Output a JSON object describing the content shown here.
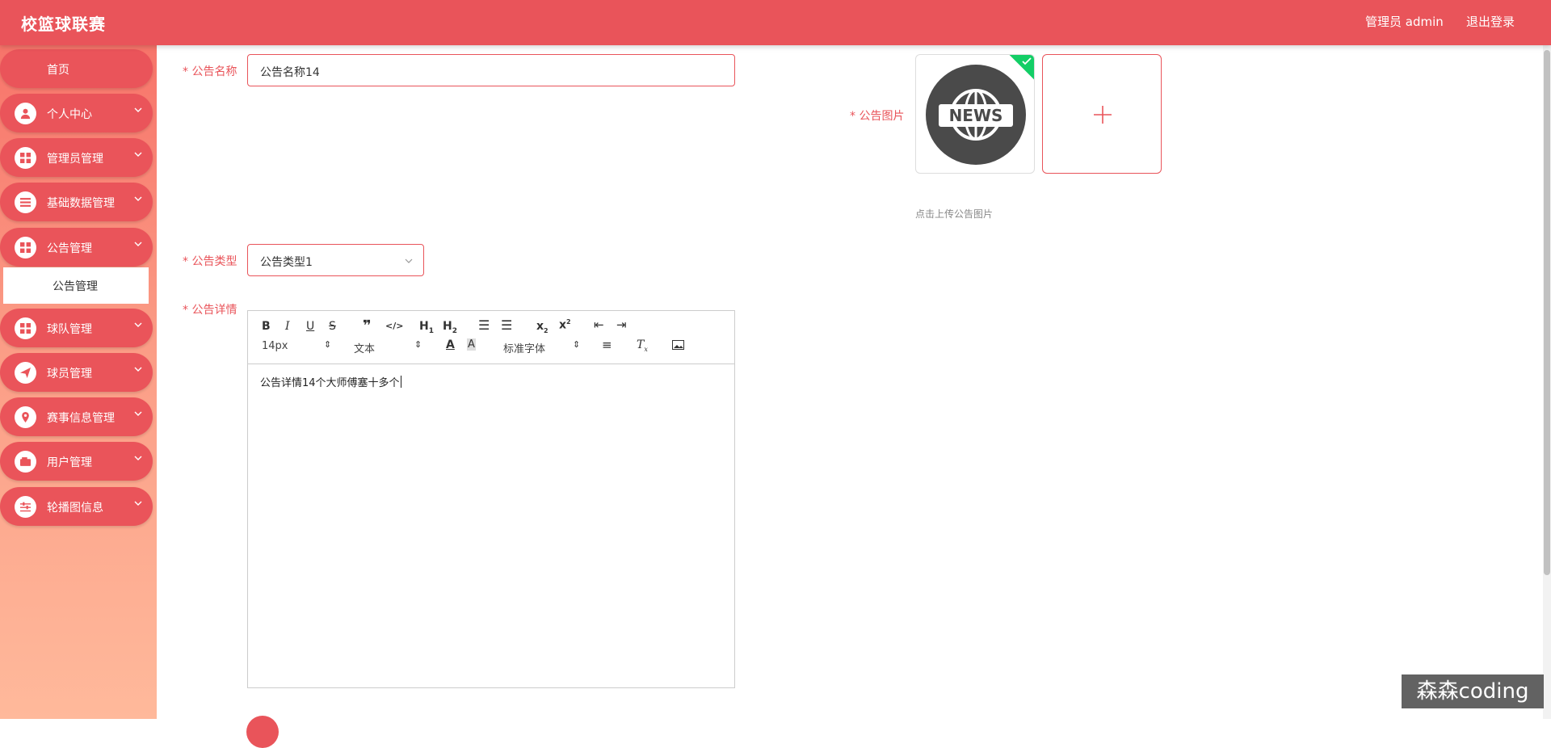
{
  "header": {
    "app_title": "校篮球联赛",
    "admin_label": "管理员 admin",
    "logout_label": "退出登录"
  },
  "sidebar": {
    "items": [
      {
        "label": "首页",
        "icon": "home-icon"
      },
      {
        "label": "个人中心",
        "icon": "user-icon"
      },
      {
        "label": "管理员管理",
        "icon": "grid-icon"
      },
      {
        "label": "基础数据管理",
        "icon": "list-icon"
      },
      {
        "label": "公告管理",
        "icon": "grid-icon"
      },
      {
        "label": "球队管理",
        "icon": "grid-icon"
      },
      {
        "label": "球员管理",
        "icon": "send-icon"
      },
      {
        "label": "赛事信息管理",
        "icon": "location-icon"
      },
      {
        "label": "用户管理",
        "icon": "wallet-icon"
      },
      {
        "label": "轮播图信息",
        "icon": "sliders-icon"
      }
    ],
    "submenu": {
      "label": "公告管理"
    }
  },
  "form": {
    "name_label": "公告名称",
    "name_value": "公告名称14",
    "image_label": "公告图片",
    "upload_tip": "点击上传公告图片",
    "image_caption": "NEWS",
    "type_label": "公告类型",
    "type_value": "公告类型1",
    "detail_label": "公告详情",
    "required_mark": "*"
  },
  "editor": {
    "font_size": "14px",
    "block_format": "文本",
    "font_family": "标准字体",
    "content": "公告详情14个大师傅塞十多个"
  },
  "watermark": "森森coding",
  "colors": {
    "accent": "#e9545a"
  }
}
